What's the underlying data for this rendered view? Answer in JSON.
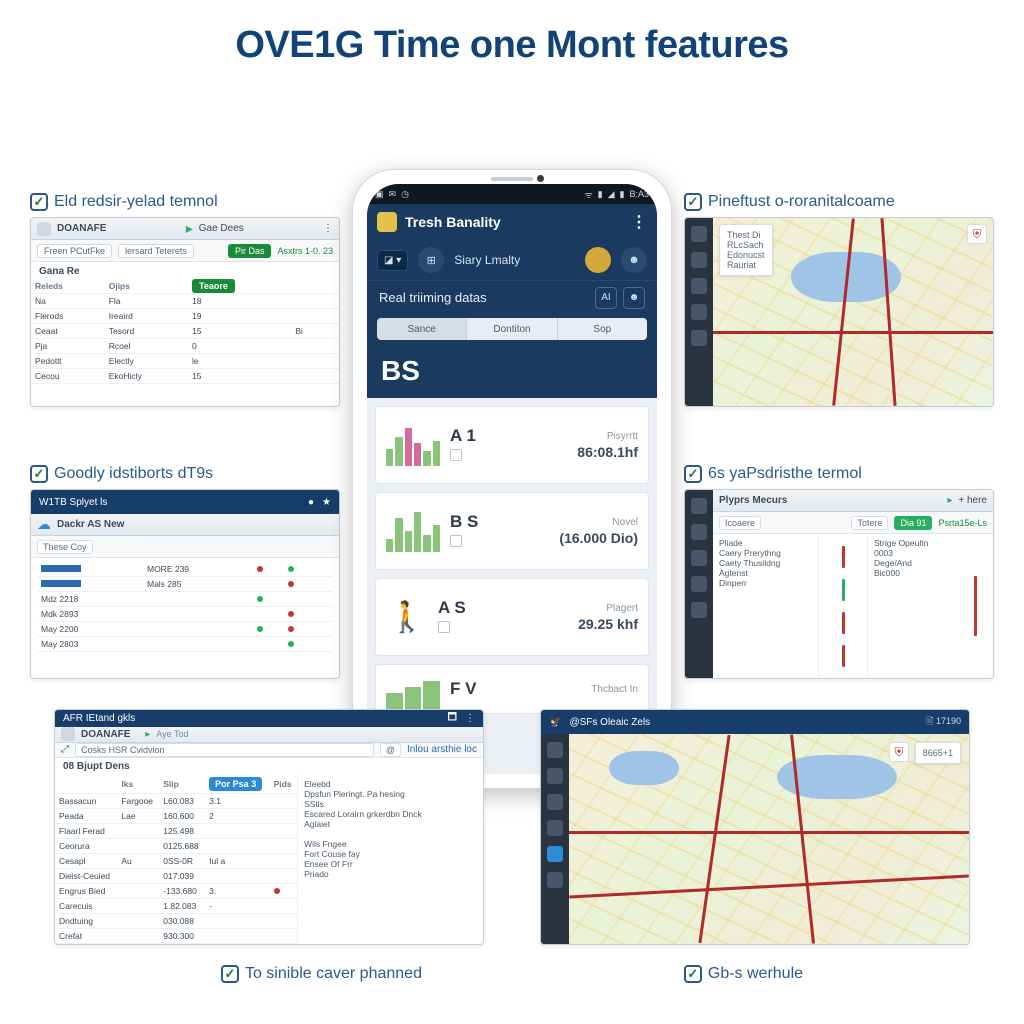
{
  "title": "OVE1G Time one Mont features",
  "panels": {
    "topLeft": {
      "caption": "Eld redsir-yelad temnol",
      "titlebar": "DOANAFE",
      "play_label": "Gae Dees",
      "tool1": "Freen PCutFke",
      "tool2": "lersard Teterets",
      "tab3": "Pir Das",
      "tab4": "Asxtrs 1-0. 23",
      "section": "Gana Re",
      "cols": [
        "Releds",
        "Ojips",
        "",
        "",
        ""
      ],
      "rows": [
        [
          "Na",
          "Fla",
          "18",
          "",
          ""
        ],
        [
          "Flerods",
          "Ireaird",
          "19",
          "",
          ""
        ],
        [
          "Ceaat",
          "Tesord",
          "15",
          "Bi",
          ""
        ],
        [
          "Pja",
          "Rcoel",
          "0",
          "",
          ""
        ],
        [
          "Pedotlt",
          "Electly",
          "le",
          "",
          ""
        ],
        [
          "Cecou",
          "EkoHicly",
          "15",
          "",
          ""
        ]
      ]
    },
    "midLeft": {
      "caption": "Goodly idstiborts dT9s",
      "titlebar": "W1TB Splyet ls",
      "brand": "Dackr AS New",
      "tab1": "These Coy",
      "rows": [
        [
          "          ",
          "MORE 239",
          "",
          "",
          ""
        ],
        [
          "          ",
          "Mals 285",
          "",
          "",
          ""
        ],
        [
          "Mdz 2218",
          "",
          "",
          "",
          ""
        ],
        [
          "Mdk 2893",
          "",
          "",
          "",
          ""
        ],
        [
          "May 2200",
          "",
          "",
          "",
          ""
        ],
        [
          "May 2803",
          "",
          "",
          "",
          ""
        ]
      ]
    },
    "topRight": {
      "caption": "Pineftust o-roranitalcoame",
      "side_card": [
        "Thest Di",
        "RLcSach",
        "Edonucst",
        "Rauriat"
      ]
    },
    "midRight": {
      "caption": "6s yaPsdristhe termol",
      "header": "Plyprs Mecurs",
      "play_label": "+ here",
      "tab1": "Icoaere",
      "tab2": "Totere",
      "tab3": "Dia 91",
      "green": "Psrta15e-Ls",
      "left_col": [
        "Pliade",
        "Caery Prerythng",
        "Caety Thusildng",
        "Agtenst",
        "Dinperr"
      ],
      "right_col": [
        "Strige Opeultn",
        "0003",
        "Dege/And",
        "Bic000"
      ]
    },
    "bottomLeft": {
      "titlebar": "AFR IEtand gkls",
      "brand": "DOANAFE",
      "brand_sub": "Aye Tod",
      "search": "Cosks HSR Cvidvion",
      "link": "Inlou arsthie loc",
      "section": "08 Bjupt Dens",
      "cols": [
        "",
        "Iks",
        "Slip",
        "Por Psa 3",
        "Pids",
        ""
      ],
      "rows": [
        [
          "Bassacun",
          "Fargooe",
          "L60.083",
          "3.1",
          "Eleebd",
          ""
        ],
        [
          "Peada",
          "Lae",
          "160.600",
          "2",
          "Dpsfun Pleringt. Pa hesing",
          ""
        ],
        [
          "Flaarl Ferad",
          "",
          "125.498",
          "",
          "SStls",
          ""
        ],
        [
          "Ceorura",
          "",
          "0125.688",
          "",
          "Escared Lorairn grkerdbn Dnck",
          ""
        ],
        [
          "Cesapl",
          "Au",
          "0SS-0R",
          "Iul a",
          "Aglaiet",
          ""
        ],
        [
          "Dieist-Ceuied",
          "",
          "017.039",
          "",
          "",
          ""
        ],
        [
          "Engrus Bied",
          "",
          "-133.680",
          "3.",
          "Wils Fngee",
          ""
        ],
        [
          "Carecuis",
          "",
          "1.82.083",
          "-",
          "Fort Couse fay",
          ""
        ],
        [
          "Dndtuing",
          "",
          "030.088",
          "",
          "Ensee Of Frr",
          ""
        ],
        [
          "Crefat",
          "",
          "930.300",
          "",
          "Priado",
          ""
        ]
      ]
    },
    "bottomRight": {
      "titlebar": "@SFs Oleaic Zels",
      "pill": "8665+1"
    },
    "bottomCaps": {
      "left": "To sinible caver phanned",
      "right": "Gb-s werhule"
    }
  },
  "phone": {
    "status_time": "B:A3",
    "app_title": "Tresh Banality",
    "sub_label": "Siary Lmalty",
    "section": "Real triiming datas",
    "section_btn": "AI",
    "segments": [
      "Sance",
      "Dontiton",
      "Sop"
    ],
    "bs": "BS",
    "cards": [
      {
        "code": "A 1",
        "rlabel": "Pisyrrtt",
        "rvalue": "86:08.1hf"
      },
      {
        "code": "B S",
        "rlabel": "Novel",
        "rvalue": "(16.000 Dio)"
      },
      {
        "code": "A S",
        "rlabel": "Plagert",
        "rvalue": "29.25 khf"
      },
      {
        "code": "F V",
        "rlabel": "Thcbact In",
        "rvalue": ""
      }
    ]
  }
}
